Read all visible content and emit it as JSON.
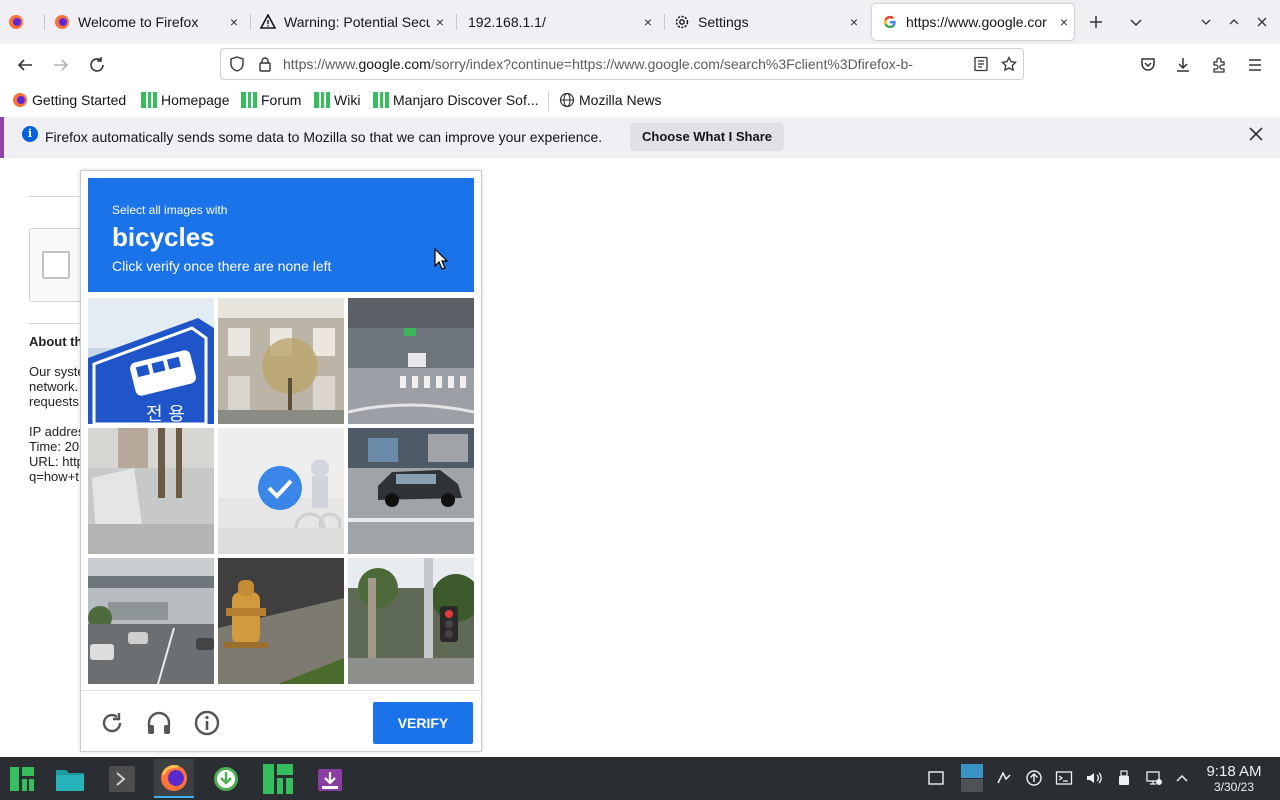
{
  "tabs": [
    {
      "title": "",
      "favicon": "firefox-icon"
    },
    {
      "title": "Welcome to Firefox",
      "favicon": "firefox-icon",
      "close": "×"
    },
    {
      "title": "Warning: Potential Secu",
      "favicon": "warning-icon",
      "close": "×"
    },
    {
      "title": "192.168.1.1/",
      "favicon": "",
      "close": "×"
    },
    {
      "title": "Settings",
      "favicon": "gear-icon",
      "close": "×"
    },
    {
      "title": "https://www.google.cor",
      "favicon": "google-icon",
      "close": "×",
      "active": true
    }
  ],
  "navbar": {
    "url_prefix": "https://www.",
    "url_domain": "google.com",
    "url_rest": "/sorry/index?continue=https://www.google.com/search%3Fclient%3Dfirefox-b-"
  },
  "bookmarks": [
    {
      "label": "Getting Started",
      "icon": "firefox-icon"
    },
    {
      "label": "Homepage",
      "icon": "manjaro-icon"
    },
    {
      "label": "Forum",
      "icon": "manjaro-icon"
    },
    {
      "label": "Wiki",
      "icon": "manjaro-icon"
    },
    {
      "label": "Manjaro Discover Sof...",
      "icon": "manjaro-icon"
    },
    {
      "label": "Mozilla News",
      "icon": "globe-icon"
    }
  ],
  "notification": {
    "message": "Firefox automatically sends some data to Mozilla so that we can improve your experience.",
    "button": "Choose What I Share"
  },
  "page": {
    "about_heading": "About th",
    "lines": [
      "Our syste",
      "network.",
      "requests",
      "IP addres",
      "Time: 20",
      "URL: http",
      "q=how+t"
    ]
  },
  "captcha": {
    "instruction": "Select all images with",
    "target": "bicycles",
    "hint": "Click verify once there are none left",
    "verify_label": "VERIFY",
    "tiles": [
      {
        "subject": "bus stop sign",
        "selected": false
      },
      {
        "subject": "house facade",
        "selected": false
      },
      {
        "subject": "street crossing",
        "selected": false
      },
      {
        "subject": "tree and sidewalk",
        "selected": false
      },
      {
        "subject": "cyclist",
        "selected": true
      },
      {
        "subject": "parked car",
        "selected": false
      },
      {
        "subject": "road under bridge",
        "selected": false
      },
      {
        "subject": "fire hydrant",
        "selected": false
      },
      {
        "subject": "traffic light",
        "selected": false
      }
    ]
  },
  "taskbar": {
    "time": "9:18 AM",
    "date": "3/30/23"
  },
  "colors": {
    "captcha_blue": "#1a73e8",
    "taskbar_bg": "#2a2e32",
    "manjaro_green": "#35bf5c"
  }
}
